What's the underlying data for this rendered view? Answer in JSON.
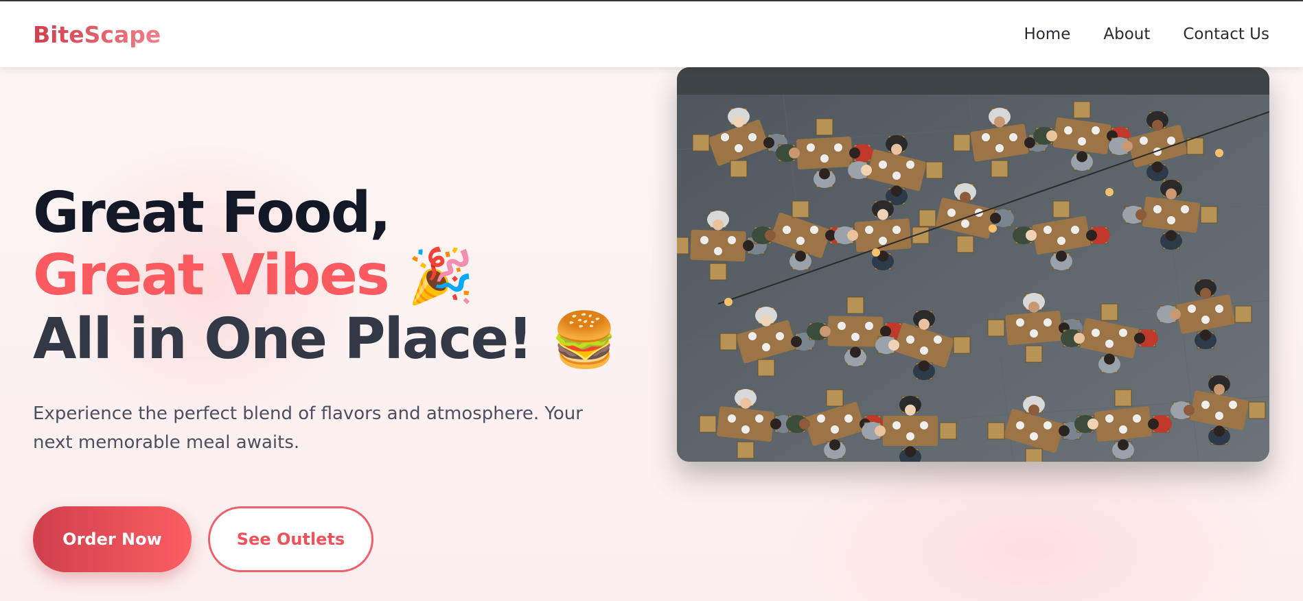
{
  "brand": {
    "name": "BiteScape"
  },
  "nav": {
    "items": [
      {
        "label": "Home"
      },
      {
        "label": "About"
      },
      {
        "label": "Contact Us"
      }
    ]
  },
  "hero": {
    "headline": {
      "line1": "Great Food,",
      "line2": "Great Vibes",
      "line2_emoji": "🎉",
      "line3": "All in One Place!",
      "line3_emoji": "🍔"
    },
    "description": "Experience the perfect blend of flavors and atmosphere. Your next memorable meal awaits.",
    "buttons": {
      "primary_label": "Order Now",
      "secondary_label": "See Outlets"
    },
    "image": {
      "subject": "aerial view of busy outdoor dining courtyard",
      "icon": "party-popper-icon, burger-icon"
    }
  },
  "colors": {
    "accent": "#fb5a60",
    "accent_dark": "#cf3f4c",
    "headline_dark": "#121826",
    "nav_text": "#2a2a35"
  }
}
